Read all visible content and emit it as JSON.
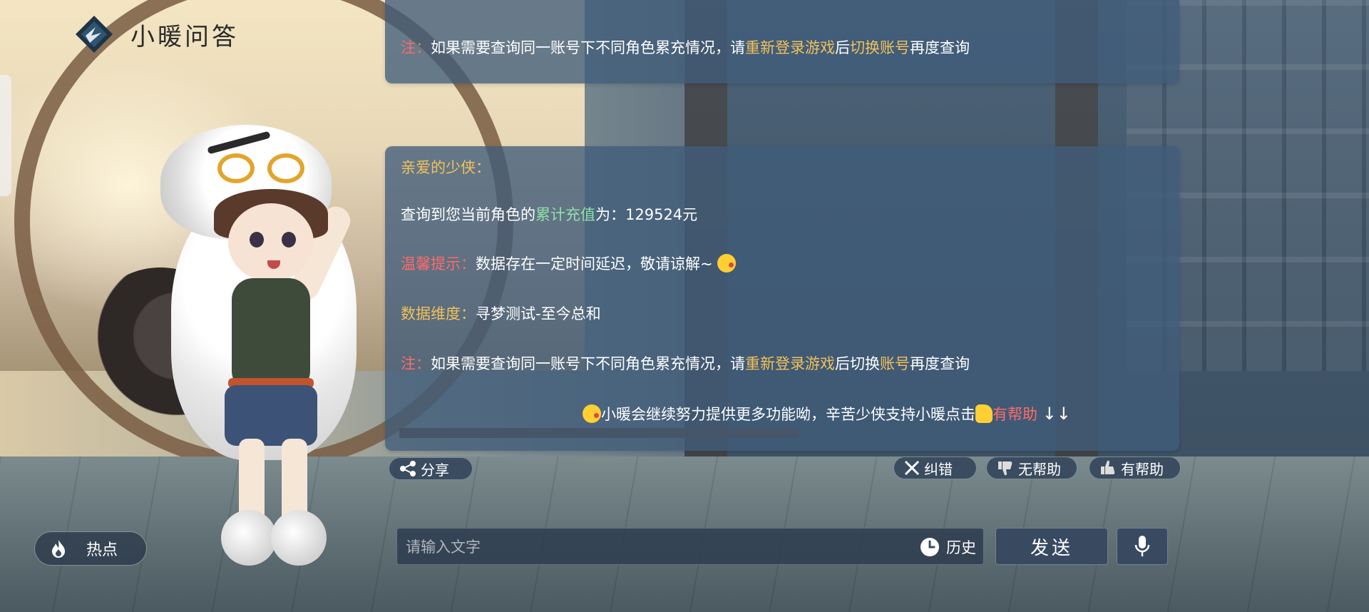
{
  "header": {
    "title": "小暖问答",
    "logo_icon": "diamond-logo-icon"
  },
  "messages": {
    "top_note": {
      "prefix": "注：",
      "text_a": "如果需要查询同一账号下不同角色累充情况，请",
      "link_a": "重新登录游戏",
      "text_b": "后",
      "link_b": "切换账号",
      "text_c": "再度查询"
    },
    "main": {
      "greeting": "亲爱的少侠：",
      "query_prefix": "查询到您当前角色的",
      "query_highlight": "累计充值",
      "query_suffix": "为：129524元",
      "tip_label": "温馨提示：",
      "tip_text": "数据存在一定时间延迟，敬请谅解~",
      "dimension_label": "数据维度：",
      "dimension_value": "寻梦测试-至今总和",
      "note_prefix": "注：",
      "note_a": "如果需要查询同一账号下不同角色累充情况，请",
      "note_link_a": "重新登录游戏",
      "note_b": "后切换",
      "note_link_b": "账号",
      "note_c": "再度查询",
      "footer_text": "小暖会继续努力提供更多功能呦，辛苦少侠支持小暖点击",
      "footer_link": "有帮助",
      "footer_arrows": "↓↓"
    }
  },
  "actions": {
    "share": "分享",
    "correct": "纠错",
    "unhelpful": "无帮助",
    "helpful": "有帮助"
  },
  "bottom": {
    "hot_label": "热点",
    "input_placeholder": "请输入文字",
    "history_label": "历史",
    "send_label": "发送"
  },
  "colors": {
    "card_bg": "#405c7a",
    "highlight_red": "#ff6b6b",
    "highlight_gold": "#f2c15a",
    "highlight_green": "#8fe0a8"
  }
}
